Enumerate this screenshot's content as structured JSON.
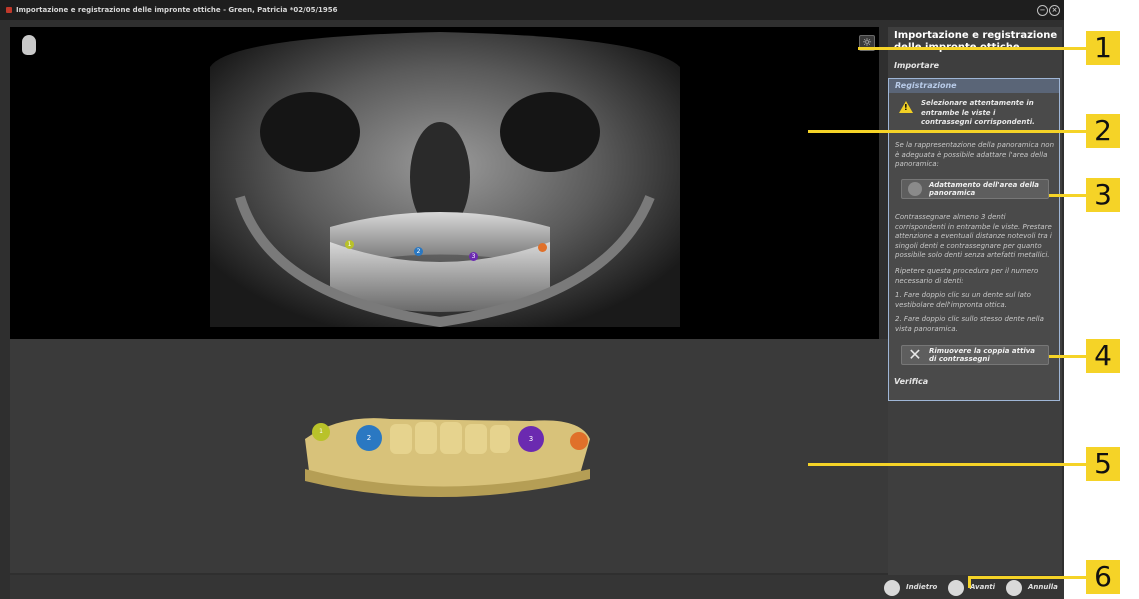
{
  "window": {
    "title": "Importazione e registrazione delle impronte ottiche - Green, Patricia *02/05/1956",
    "minimize_glyph": "−",
    "close_glyph": "×"
  },
  "panel": {
    "title": "Importazione e registrazione delle impronte ottiche",
    "sections": {
      "import": "Importare",
      "registration": "Registrazione",
      "verify": "Verifica"
    },
    "warning": "Selezionare attentamente in entrambe le viste i contrassegni corrispondenti.",
    "para1": "Se la rappresentazione della panoramica non è adeguata è possibile adattare l'area della panoramica:",
    "adapt_button": "Adattamento dell'area della panoramica",
    "para2": "Contrassegnare almeno 3 denti corrispondenti in entrambe le viste. Prestare attenzione a eventuali distanze notevoli tra i singoli denti e contrassegnare per quanto possibile solo denti senza artefatti metallici.",
    "para3": "Ripetere questa procedura per il numero necessario di denti:",
    "step1": "1. Fare doppio clic su un dente sul lato vestibolare dell'impronta ottica.",
    "step2": "2. Fare doppio clic sullo stesso dente nella vista panoramica.",
    "remove_button": "Rimuovere la coppia attiva di contrassegni"
  },
  "markers": [
    {
      "label": "1",
      "color": "#b9c22a"
    },
    {
      "label": "2",
      "color": "#2a78c2"
    },
    {
      "label": "3",
      "color": "#6b2ab0"
    },
    {
      "label": "",
      "color": "#e0702a"
    }
  ],
  "nav": {
    "back": "Indietro",
    "next": "Avanti",
    "cancel": "Annulla"
  },
  "callouts": [
    "1",
    "2",
    "3",
    "4",
    "5",
    "6"
  ],
  "colors": {
    "callout": "#f5d327",
    "panel_bg": "#3e3e3e",
    "highlight_border": "#9fb6d6"
  }
}
